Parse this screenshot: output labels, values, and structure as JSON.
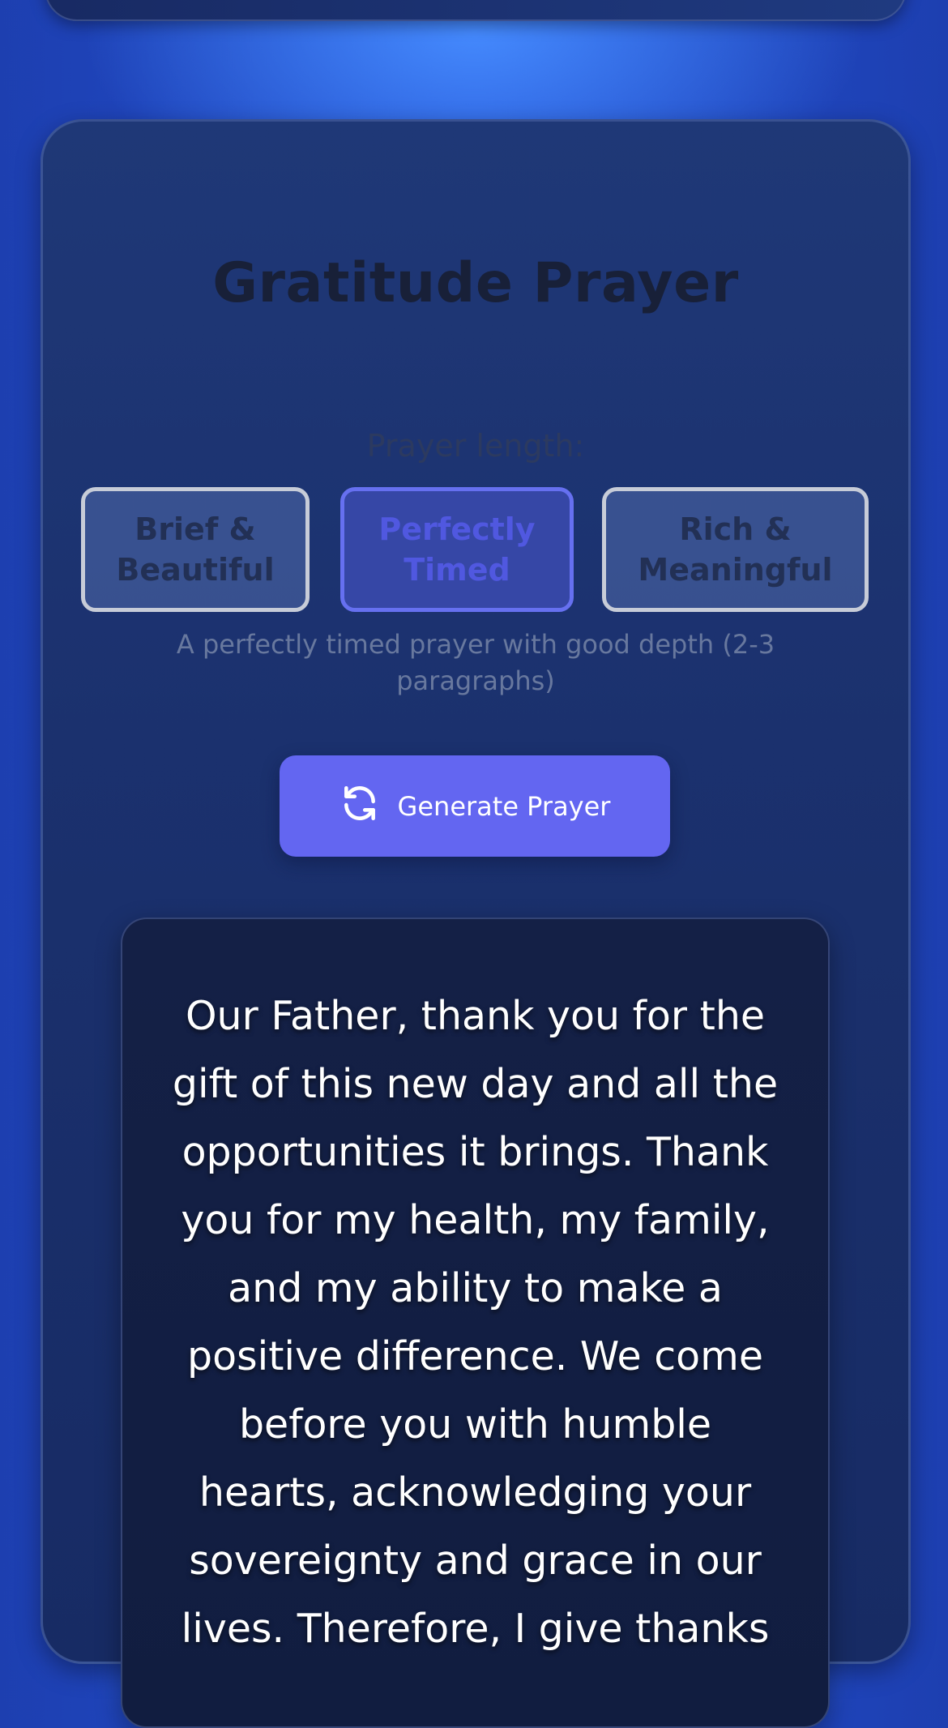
{
  "prayer": {
    "title": "Gratitude Prayer",
    "length_label": "Prayer length:",
    "length_options": [
      {
        "label": "Brief & Beautiful",
        "selected": false
      },
      {
        "label": "Perfectly Timed",
        "selected": true
      },
      {
        "label": "Rich & Meaningful",
        "selected": false
      }
    ],
    "length_description": "A perfectly timed prayer with good depth (2-3 paragraphs)",
    "generate_button": {
      "label": "Generate Prayer",
      "icon": "refresh-icon"
    },
    "text": "Our Father, thank you for the gift of this new day and all the opportunities it brings. Thank you for my health, my family, and my ability to make a positive difference. We come before you with humble hearts, acknowledging your sovereignty and grace in our lives. Therefore, I give thanks"
  },
  "colors": {
    "accent": "#6366f1",
    "selected_text": "#5058e0",
    "card_background": "#1f3877",
    "prayer_box_background": "#142046"
  }
}
